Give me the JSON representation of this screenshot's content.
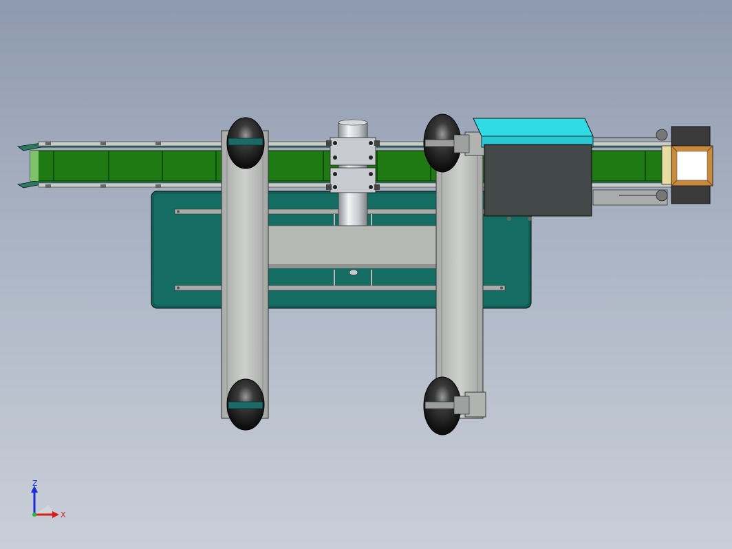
{
  "triad": {
    "z_label": "Z",
    "x_label": "X",
    "z_color": "#1a2bd6",
    "x_color": "#d81b1b",
    "y_color": "#1fbf3a"
  },
  "colors": {
    "conveyor_belt": "#1f7a14",
    "base_frame": "#14695f",
    "side_rails": "#b9bdb9",
    "motor_box_top": "#30dbe6",
    "motor_box_body": "#3e4343",
    "wheels": "#222222",
    "wheel_bands": "#1a6a68",
    "gear_motor": "#3b3b3b",
    "cover_plate": "#c98a3c"
  },
  "icons": [
    "view-triad-icon"
  ]
}
